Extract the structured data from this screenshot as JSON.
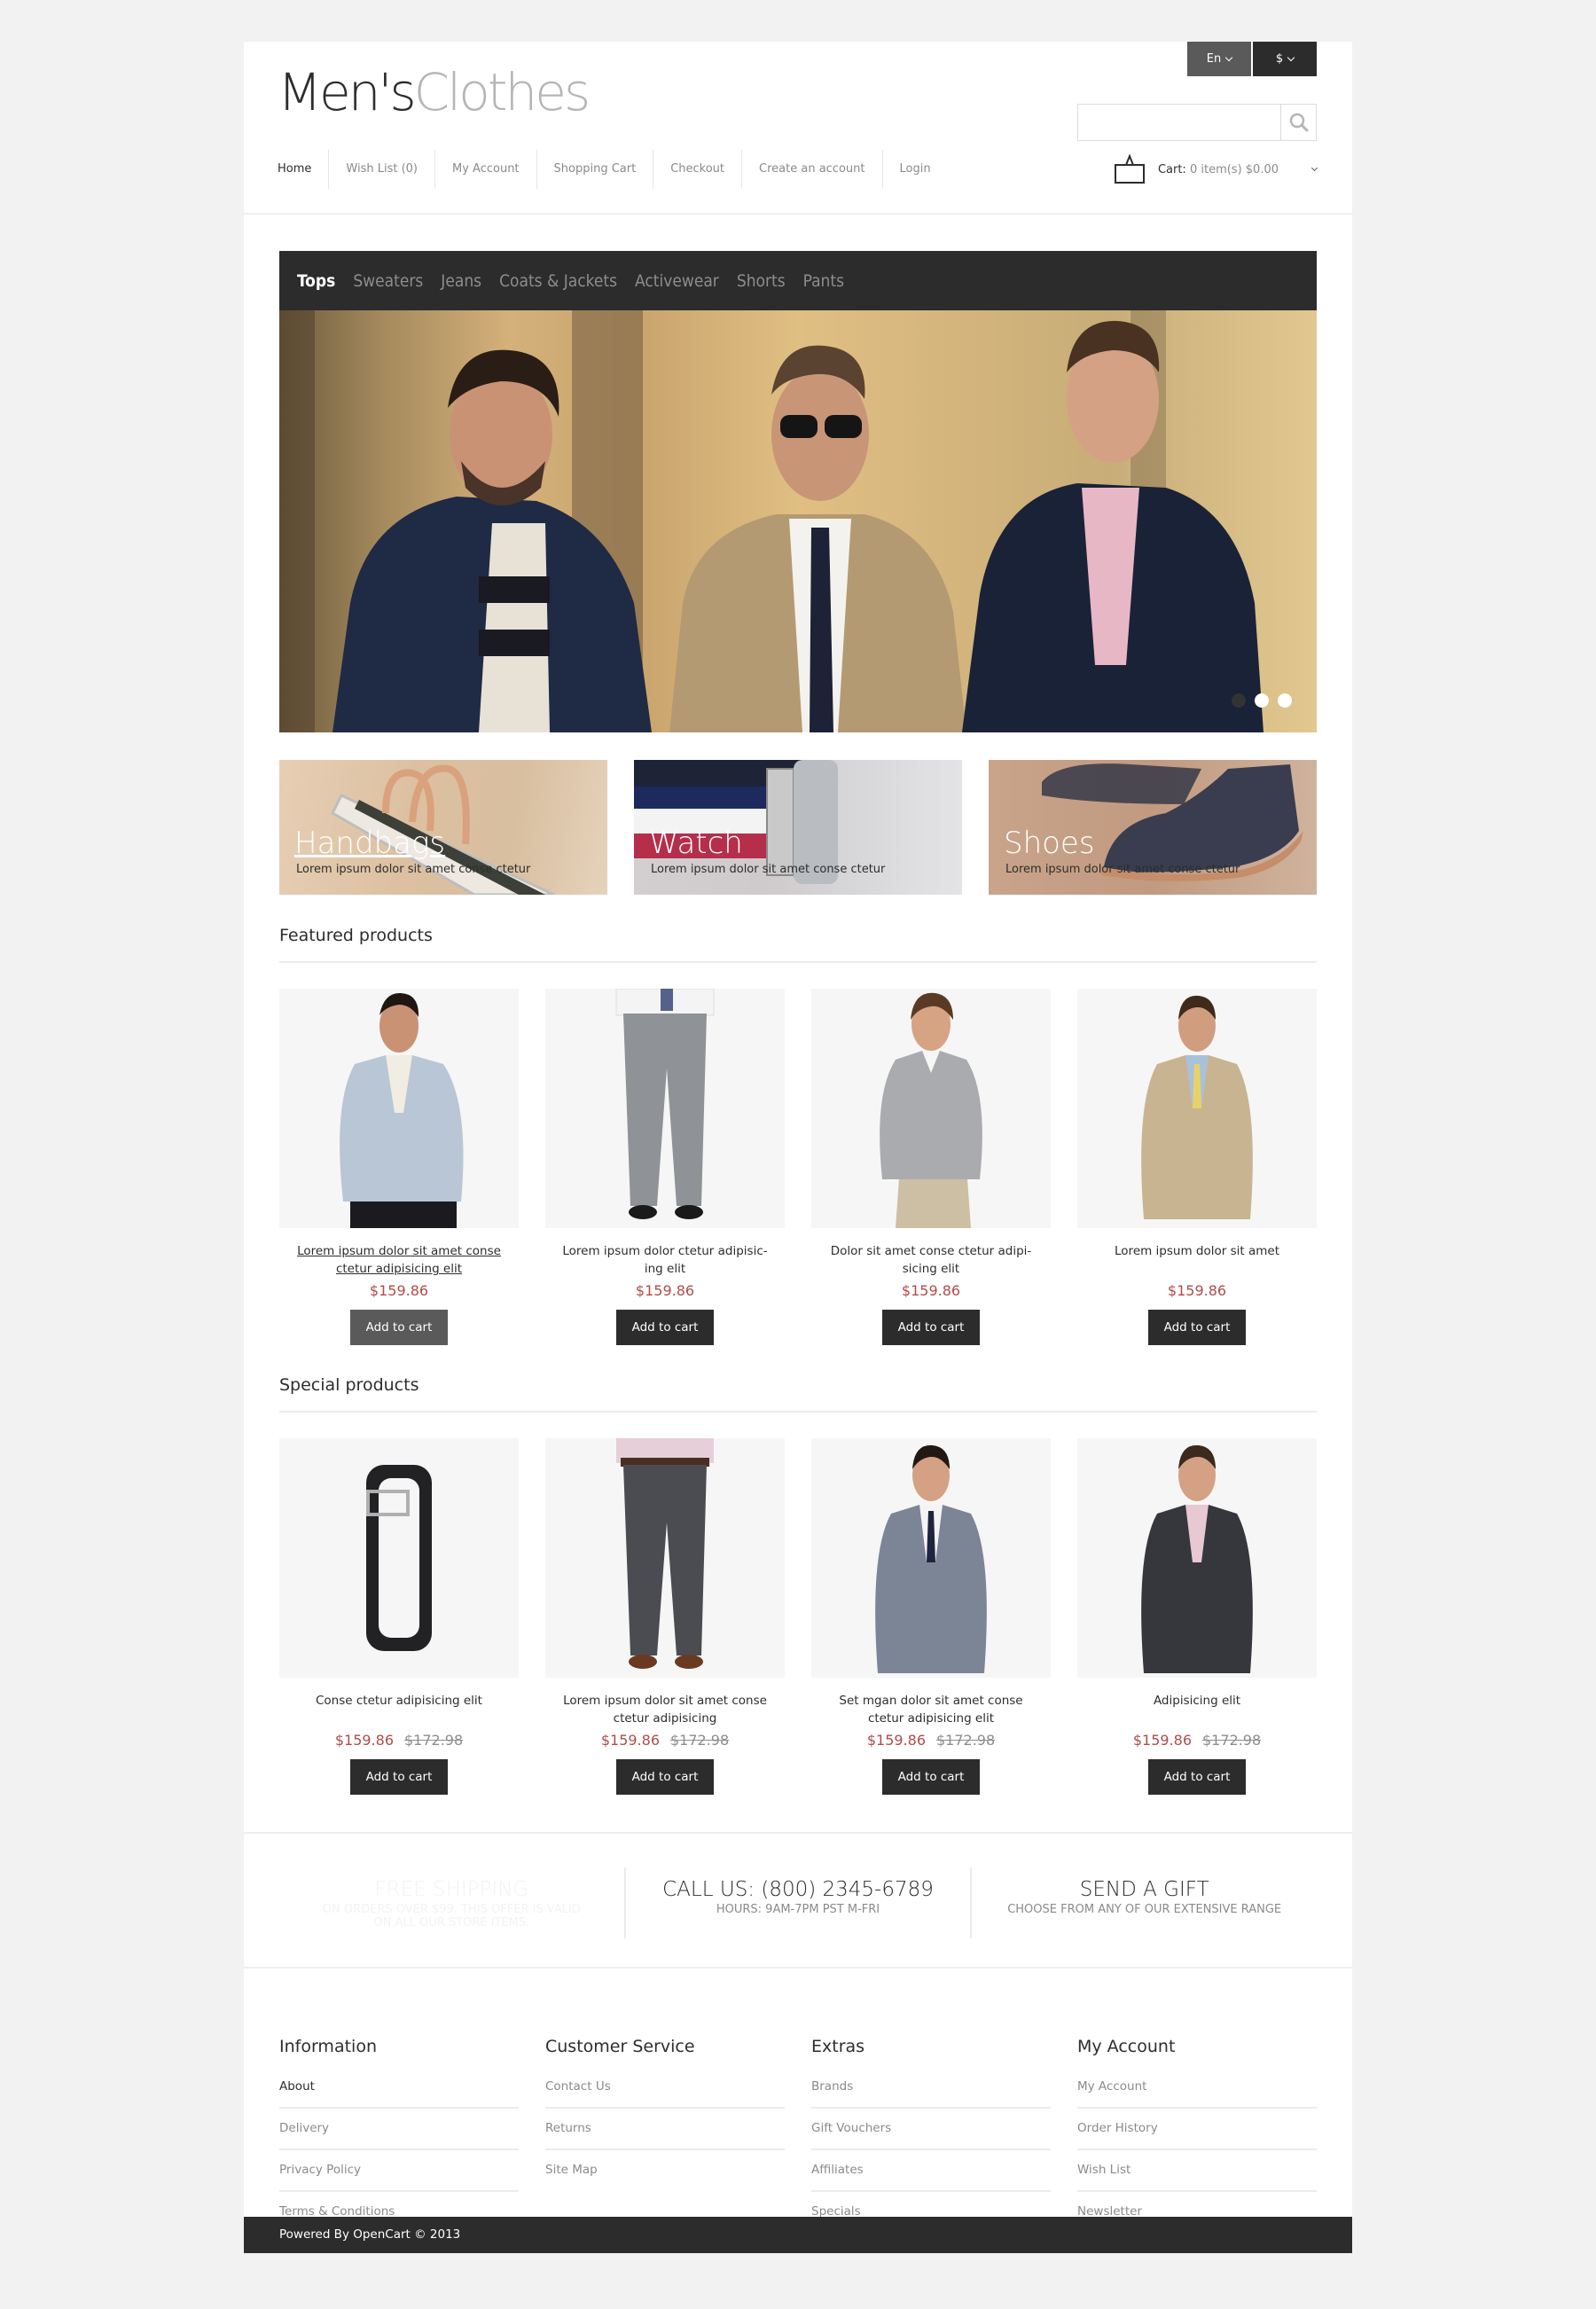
{
  "header": {
    "language": "En",
    "currency": "$",
    "logo_part1": "Men's",
    "logo_part2": "Clothes",
    "search_placeholder": "",
    "search_value": "",
    "nav": [
      "Home",
      "Wish List (0)",
      "My Account",
      "Shopping Cart",
      "Checkout",
      "Create an account",
      "Login"
    ],
    "cart_label": "Cart:",
    "cart_summary": "0 item(s) $0.00"
  },
  "categories": [
    "Tops",
    "Sweaters",
    "Jeans",
    "Coats & Jackets",
    "Activewear",
    "Shorts",
    "Pants"
  ],
  "active_category": "Tops",
  "slider": {
    "slide_count": 3,
    "active_slide": 1
  },
  "banners": [
    {
      "title": "Handbags",
      "subtitle": "Lorem ipsum dolor sit amet conse ctetur"
    },
    {
      "title": "Watch",
      "subtitle": "Lorem ipsum dolor sit amet conse ctetur"
    },
    {
      "title": "Shoes",
      "subtitle": "Lorem ipsum dolor sit amet conse ctetur"
    }
  ],
  "featured": {
    "title": "Featured products",
    "products": [
      {
        "name": "Lorem ipsum dolor sit amet conse ctetur adipisicing elit",
        "price": "$159.86",
        "button": "Add to cart",
        "image": "light-blue-blazer"
      },
      {
        "name": "Lorem ipsum dolor ctetur adipisic-ing elit",
        "price": "$159.86",
        "button": "Add to cart",
        "image": "grey-trousers"
      },
      {
        "name": "Dolor sit amet conse ctetur adipi-sicing elit",
        "price": "$159.86",
        "button": "Add to cart",
        "image": "grey-v-neck-sweater"
      },
      {
        "name": "Lorem ipsum dolor sit amet",
        "price": "$159.86",
        "button": "Add to cart",
        "image": "beige-suit"
      }
    ]
  },
  "special": {
    "title": "Special products",
    "products": [
      {
        "name": "Conse ctetur adipisicing elit",
        "price": "$159.86",
        "old_price": "$172.98",
        "button": "Add to cart",
        "image": "black-belt"
      },
      {
        "name": "Lorem ipsum dolor sit amet conse ctetur adipisicing",
        "price": "$159.86",
        "old_price": "$172.98",
        "button": "Add to cart",
        "image": "charcoal-trousers"
      },
      {
        "name": "Set mgan dolor sit amet conse ctetur adipisicing elit",
        "price": "$159.86",
        "old_price": "$172.98",
        "button": "Add to cart",
        "image": "grey-suit"
      },
      {
        "name": "Adipisicing elit",
        "price": "$159.86",
        "old_price": "$172.98",
        "button": "Add to cart",
        "image": "dark-suit"
      }
    ]
  },
  "info": [
    {
      "heading": "FREE SHIPPING",
      "sub": "ON ORDERS OVER $99. THIS OFFER IS VALID ON ALL OUR STORE ITEMS."
    },
    {
      "heading": "CALL US: (800) 2345-6789",
      "sub": "HOURS: 9AM-7PM PST M-FRI"
    },
    {
      "heading": "SEND A GIFT",
      "sub": "CHOOSE FROM ANY OF OUR EXTENSIVE RANGE"
    }
  ],
  "footer": {
    "columns": [
      {
        "heading": "Information",
        "links": [
          "About",
          "Delivery",
          "Privacy Policy",
          "Terms & Conditions"
        ]
      },
      {
        "heading": "Customer Service",
        "links": [
          "Contact Us",
          "Returns",
          "Site Map"
        ]
      },
      {
        "heading": "Extras",
        "links": [
          "Brands",
          "Gift Vouchers",
          "Affiliates",
          "Specials"
        ]
      },
      {
        "heading": "My Account",
        "links": [
          "My Account",
          "Order History",
          "Wish List",
          "Newsletter"
        ]
      }
    ],
    "copyright": "Powered By OpenCart © 2013"
  },
  "colors": {
    "dark": "#2c2c2c",
    "price": "#b24b4b",
    "muted": "#8a8a8a"
  }
}
